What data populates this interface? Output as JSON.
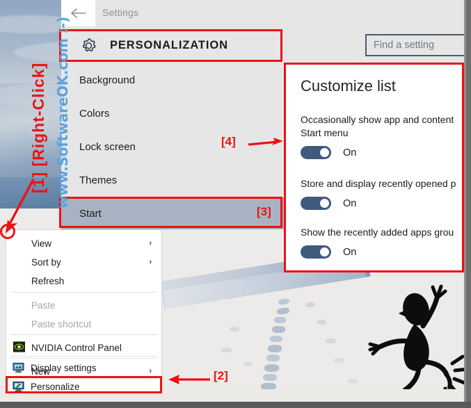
{
  "watermarks": {
    "top": "www.SoftwareOK.com  :-)",
    "left_blue": "www.SoftwareOK.com :-)",
    "left_red": "[1] [Right-Click]"
  },
  "settings_window": {
    "title": "Settings",
    "back_icon": "back-arrow-icon",
    "header": {
      "icon": "gear-icon",
      "title": "PERSONALIZATION"
    },
    "search": {
      "placeholder": "Find a setting",
      "value": "Find a setting"
    },
    "nav_items": [
      {
        "label": "Background",
        "selected": false
      },
      {
        "label": "Colors",
        "selected": false
      },
      {
        "label": "Lock screen",
        "selected": false
      },
      {
        "label": "Themes",
        "selected": false
      },
      {
        "label": "Start",
        "selected": true
      }
    ]
  },
  "customize_panel": {
    "title": "Customize list",
    "groups": [
      {
        "label": "Occasionally show app and content\nStart menu",
        "toggle_state": "On",
        "toggle_on": true
      },
      {
        "label": "Store and display recently opened p",
        "toggle_state": "On",
        "toggle_on": true
      },
      {
        "label": "Show the recently added apps grou",
        "toggle_state": "On",
        "toggle_on": true
      }
    ]
  },
  "context_menu": {
    "items": [
      {
        "label": "View",
        "submenu": "›",
        "disabled": false,
        "icon": ""
      },
      {
        "label": "Sort by",
        "submenu": "›",
        "disabled": false,
        "icon": ""
      },
      {
        "label": "Refresh",
        "submenu": "",
        "disabled": false,
        "icon": ""
      },
      {
        "label": "Paste",
        "submenu": "",
        "disabled": true,
        "icon": ""
      },
      {
        "label": "Paste shortcut",
        "submenu": "",
        "disabled": true,
        "icon": ""
      },
      {
        "label": "NVIDIA Control Panel",
        "submenu": "",
        "disabled": false,
        "icon": "nvidia-icon"
      },
      {
        "label": "New",
        "submenu": "›",
        "disabled": false,
        "icon": ""
      },
      {
        "label": "Display settings",
        "submenu": "",
        "disabled": false,
        "icon": "monitor-icon"
      },
      {
        "label": "Personalize",
        "submenu": "",
        "disabled": false,
        "icon": "personalize-monitor-icon"
      }
    ]
  },
  "annotations": {
    "marker1": "[1]",
    "marker2": "[2]",
    "marker3": "[3]",
    "marker4": "[4]",
    "accent_color": "#ee1111",
    "watermark_color": "#4f9de0"
  }
}
